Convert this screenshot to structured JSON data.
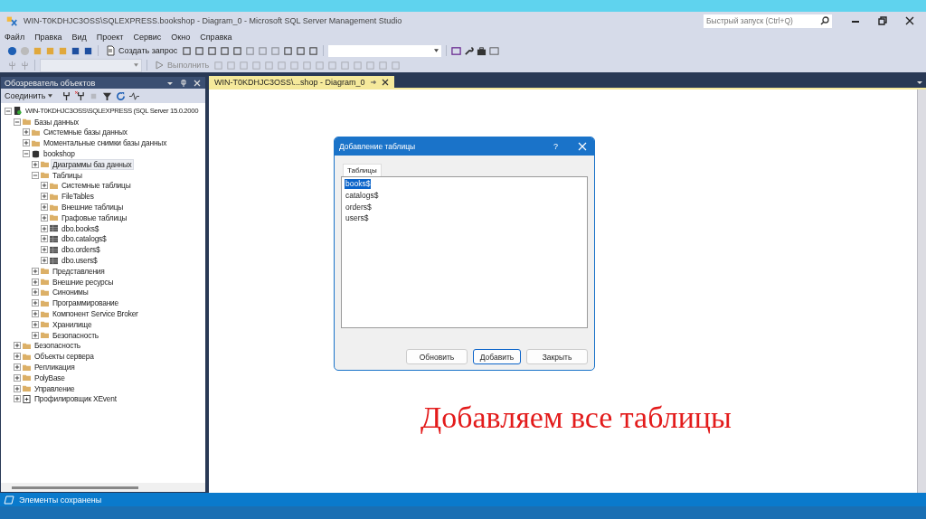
{
  "window": {
    "title": "WIN-T0KDHJC3OSS\\SQLEXPRESS.bookshop - Diagram_0 - Microsoft SQL Server Management Studio"
  },
  "quick_launch": {
    "placeholder": "Быстрый запуск (Ctrl+Q)"
  },
  "menu": [
    "Файл",
    "Правка",
    "Вид",
    "Проект",
    "Сервис",
    "Окно",
    "Справка"
  ],
  "toolbar": {
    "new_query": "Создать запрос",
    "execute": {
      "label": "Выполнить",
      "disabled": true
    }
  },
  "object_explorer": {
    "title": "Обозреватель объектов",
    "connect": "Соединить",
    "tree": [
      {
        "kind": "server",
        "label": "WIN-T0KDHJC3OSS\\SQLEXPRESS (SQL Server 15.0.2000",
        "expanded": true,
        "selected": false,
        "children": [
          {
            "kind": "folder",
            "label": "Базы данных",
            "expanded": true,
            "selected": false,
            "children": [
              {
                "kind": "folder",
                "label": "Системные базы данных",
                "expanded": false,
                "selected": false
              },
              {
                "kind": "folder",
                "label": "Моментальные снимки базы данных",
                "expanded": false,
                "selected": false
              },
              {
                "kind": "database",
                "label": "bookshop",
                "expanded": true,
                "selected": false,
                "children": [
                  {
                    "kind": "folder",
                    "label": "Диаграммы баз данных",
                    "expanded": false,
                    "selected": true
                  },
                  {
                    "kind": "folder",
                    "label": "Таблицы",
                    "expanded": true,
                    "selected": false,
                    "children": [
                      {
                        "kind": "folder",
                        "label": "Системные таблицы",
                        "expanded": false,
                        "selected": false
                      },
                      {
                        "kind": "folder",
                        "label": "FileTables",
                        "expanded": false,
                        "selected": false
                      },
                      {
                        "kind": "folder",
                        "label": "Внешние таблицы",
                        "expanded": false,
                        "selected": false
                      },
                      {
                        "kind": "folder",
                        "label": "Графовые таблицы",
                        "expanded": false,
                        "selected": false
                      },
                      {
                        "kind": "table",
                        "label": "dbo.books$",
                        "expanded": false,
                        "selected": false
                      },
                      {
                        "kind": "table",
                        "label": "dbo.catalogs$",
                        "expanded": false,
                        "selected": false
                      },
                      {
                        "kind": "table",
                        "label": "dbo.orders$",
                        "expanded": false,
                        "selected": false
                      },
                      {
                        "kind": "table",
                        "label": "dbo.users$",
                        "expanded": false,
                        "selected": false
                      }
                    ]
                  },
                  {
                    "kind": "folder",
                    "label": "Представления",
                    "expanded": false,
                    "selected": false
                  },
                  {
                    "kind": "folder",
                    "label": "Внешние ресурсы",
                    "expanded": false,
                    "selected": false
                  },
                  {
                    "kind": "folder",
                    "label": "Синонимы",
                    "expanded": false,
                    "selected": false
                  },
                  {
                    "kind": "folder",
                    "label": "Программирование",
                    "expanded": false,
                    "selected": false
                  },
                  {
                    "kind": "folder",
                    "label": "Компонент Service Broker",
                    "expanded": false,
                    "selected": false
                  },
                  {
                    "kind": "folder",
                    "label": "Хранилище",
                    "expanded": false,
                    "selected": false
                  },
                  {
                    "kind": "folder",
                    "label": "Безопасность",
                    "expanded": false,
                    "selected": false
                  }
                ]
              }
            ]
          },
          {
            "kind": "folder",
            "label": "Безопасность",
            "expanded": false,
            "selected": false
          },
          {
            "kind": "folder",
            "label": "Объекты сервера",
            "expanded": false,
            "selected": false
          },
          {
            "kind": "folder",
            "label": "Репликация",
            "expanded": false,
            "selected": false
          },
          {
            "kind": "folder",
            "label": "PolyBase",
            "expanded": false,
            "selected": false
          },
          {
            "kind": "folder",
            "label": "Управление",
            "expanded": false,
            "selected": false
          },
          {
            "kind": "xevent",
            "label": "Профилировщик XEvent",
            "expanded": false,
            "selected": false
          }
        ]
      }
    ]
  },
  "document_tabs": [
    {
      "label": "WIN-T0KDHJC3OSS\\...shop - Diagram_0",
      "selected": true
    }
  ],
  "dialog": {
    "title": "Добавление таблицы",
    "help": "?",
    "tab": "Таблицы",
    "items": [
      {
        "label": "books$",
        "selected": true
      },
      {
        "label": "catalogs$",
        "selected": false
      },
      {
        "label": "orders$",
        "selected": false
      },
      {
        "label": "users$",
        "selected": false
      }
    ],
    "buttons": [
      {
        "label": "Обновить",
        "default": false
      },
      {
        "label": "Добавить",
        "default": true
      },
      {
        "label": "Закрыть",
        "default": false
      }
    ]
  },
  "caption": "Добавляем все таблицы",
  "status_bar": "Элементы сохранены"
}
